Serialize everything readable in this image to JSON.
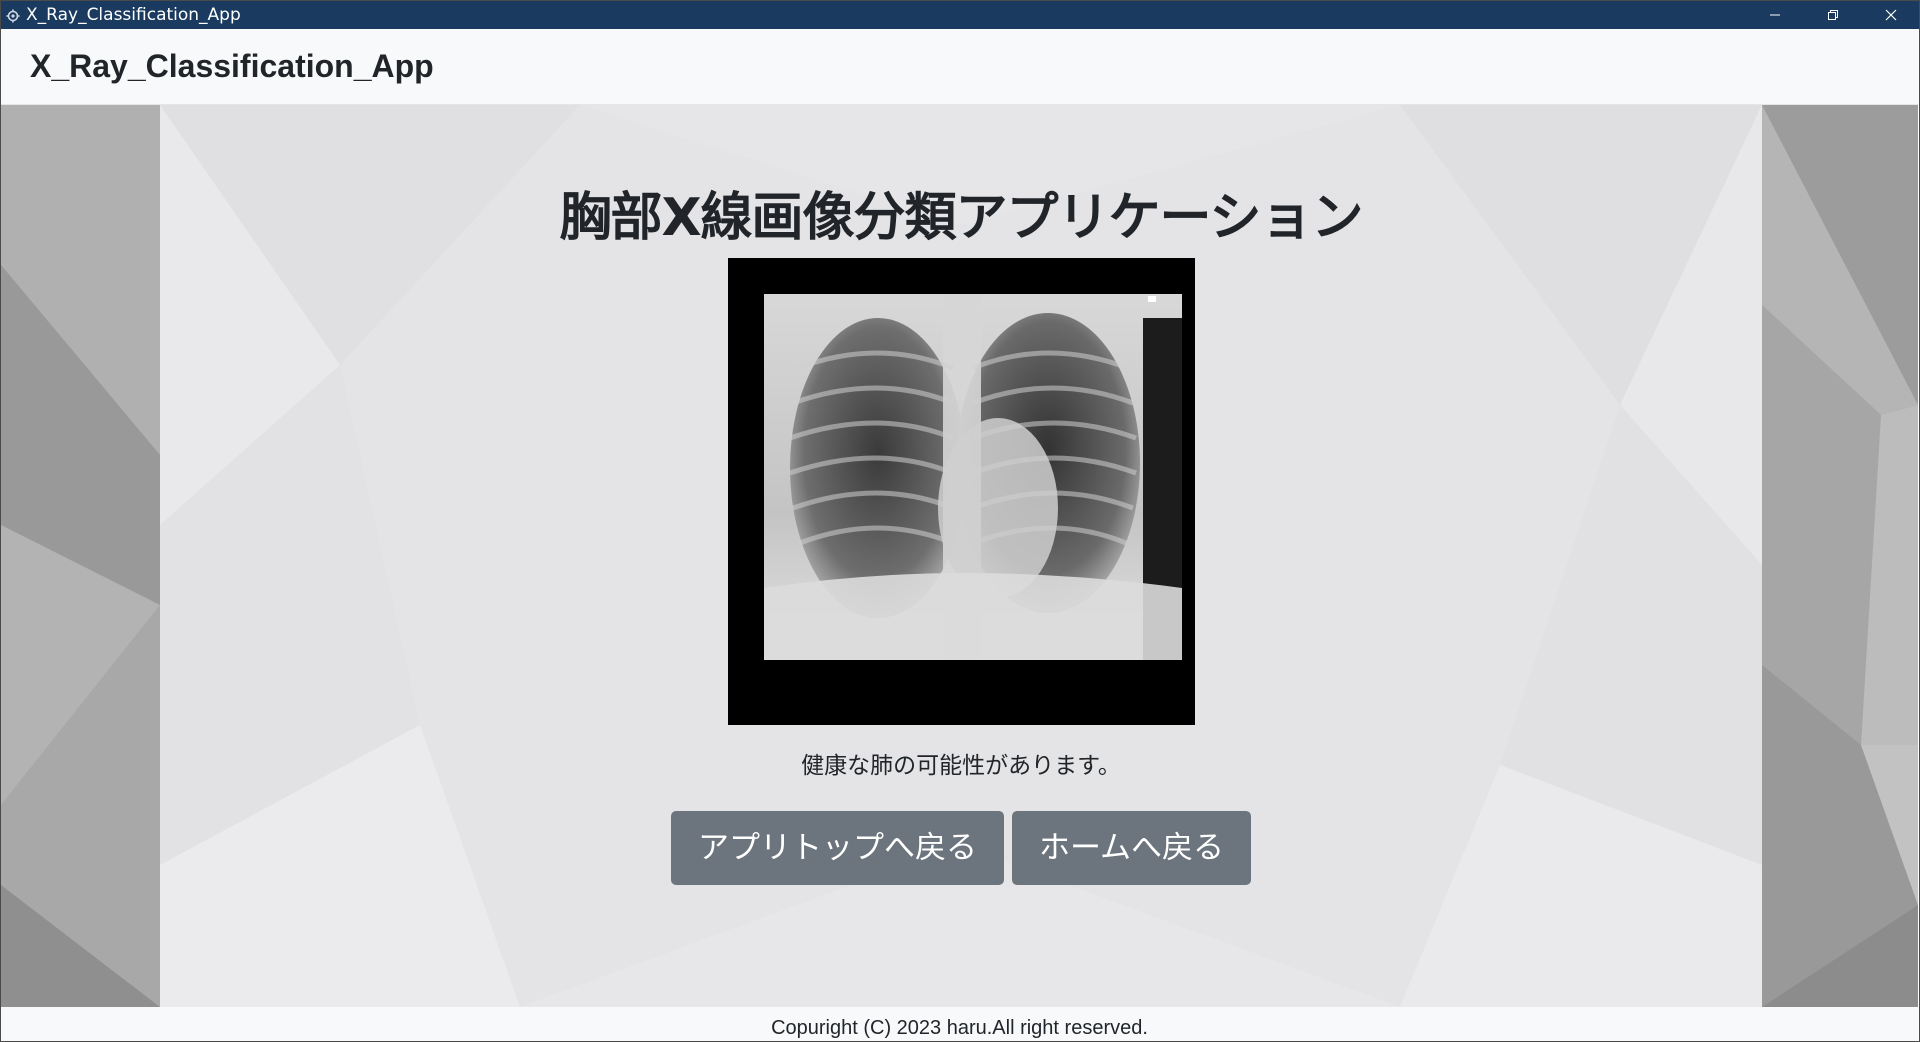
{
  "window": {
    "title": "X_Ray_Classification_App",
    "controls": {
      "minimize": "—",
      "restore": "❐",
      "close": "✕"
    }
  },
  "header": {
    "brand": "X_Ray_Classification_App"
  },
  "main": {
    "heading": "胸部X線画像分類アプリケーション",
    "result_text": "健康な肺の可能性があります。",
    "buttons": {
      "app_top": "アプリトップへ戻る",
      "home": "ホームへ戻る"
    }
  },
  "footer": {
    "copyright": "Copuright (C) 2023 haru.All right reserved."
  },
  "colors": {
    "titlebar": "#1a3a5f",
    "header_bg": "#f8f9fa",
    "button_bg": "#6c757d",
    "side_bg": "#9a9a9a",
    "panel_bg": "#e4e4e6"
  },
  "icons": {
    "app_icon": "gear-icon"
  }
}
